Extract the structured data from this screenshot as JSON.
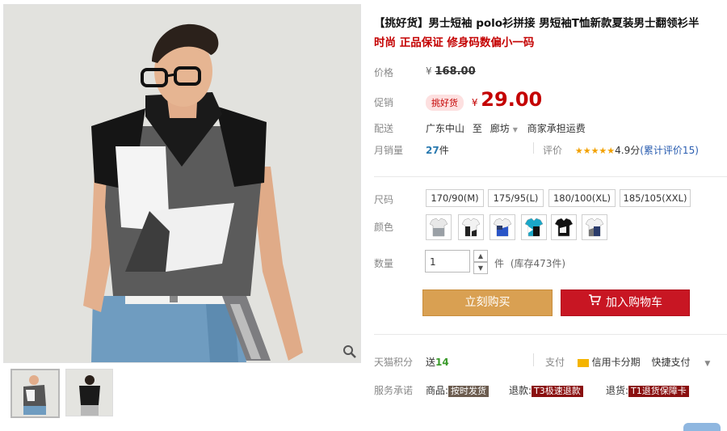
{
  "product": {
    "title": "【挑好货】男士短袖 polo衫拼接 男短袖T恤新款夏装男士翻领衫半",
    "subtitle": "时尚 正品保证 修身码数偏小一码"
  },
  "price": {
    "label": "价格",
    "currency": "¥",
    "original": "168.00",
    "promo_label": "促销",
    "promo_tag": "挑好货",
    "promo_price": "29.00"
  },
  "shipping": {
    "label": "配送",
    "from": "广东中山",
    "to_word": "至",
    "to": "廊坊",
    "fee": "商家承担运费"
  },
  "sales": {
    "label": "月销量",
    "count": "27",
    "unit": "件",
    "rating_label": "评价",
    "stars": "★★★★★",
    "score": "4.9分",
    "reviews": "(累计评价15)"
  },
  "size": {
    "label": "尺码",
    "options": [
      "170/90(M)",
      "175/95(L)",
      "180/100(XL)",
      "185/105(XXL)"
    ]
  },
  "color": {
    "label": "颜色",
    "swatches": [
      {
        "name": "white-grey",
        "accent": "#9aa0a6"
      },
      {
        "name": "white-black",
        "accent": "#222222"
      },
      {
        "name": "white-blue",
        "accent": "#2a55c7"
      },
      {
        "name": "teal-black",
        "accent": "#1aa7c8"
      },
      {
        "name": "black-white",
        "accent": "#111111"
      },
      {
        "name": "white-navy",
        "accent": "#2b3c6b"
      }
    ]
  },
  "quantity": {
    "label": "数量",
    "value": "1",
    "unit": "件",
    "stock": "(库存473件)"
  },
  "actions": {
    "buy": "立刻购买",
    "cart": "加入购物车"
  },
  "points": {
    "label": "天猫积分",
    "send": "送",
    "amount": "14",
    "pay_label": "支付",
    "credit": "信用卡分期",
    "fast": "快捷支付"
  },
  "service": {
    "label": "服务承诺",
    "goods_label": "商品:",
    "goods_badge": "按时发货",
    "refund_label": "退款:",
    "refund_badge": "T3极速退款",
    "return_label": "退货:",
    "return_badge": "T1退货保障卡"
  },
  "colors": {
    "accent_red": "#c40000",
    "buy_orange": "#d9a052",
    "cart_red": "#c81623"
  }
}
